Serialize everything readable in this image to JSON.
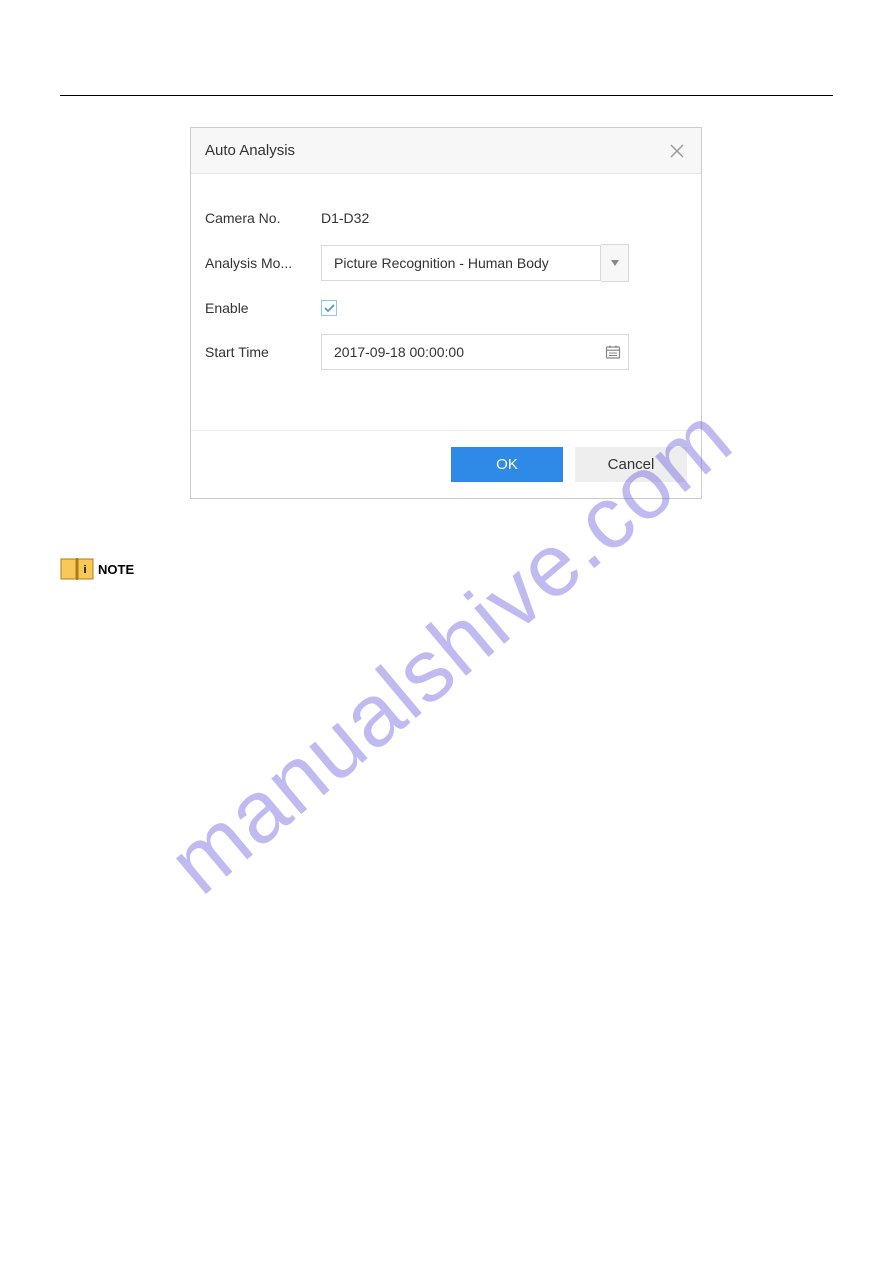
{
  "dialog": {
    "title": "Auto Analysis",
    "fields": {
      "camera_no": {
        "label": "Camera No.",
        "value": "D1-D32"
      },
      "analysis_mode": {
        "label": "Analysis Mo...",
        "value": "Picture Recognition - Human Body"
      },
      "enable": {
        "label": "Enable",
        "checked": true
      },
      "start_time": {
        "label": "Start Time",
        "value": "2017-09-18 00:00:00"
      }
    },
    "buttons": {
      "ok": "OK",
      "cancel": "Cancel"
    }
  },
  "note": {
    "label": "NOTE"
  },
  "watermark": "manualshive.com"
}
